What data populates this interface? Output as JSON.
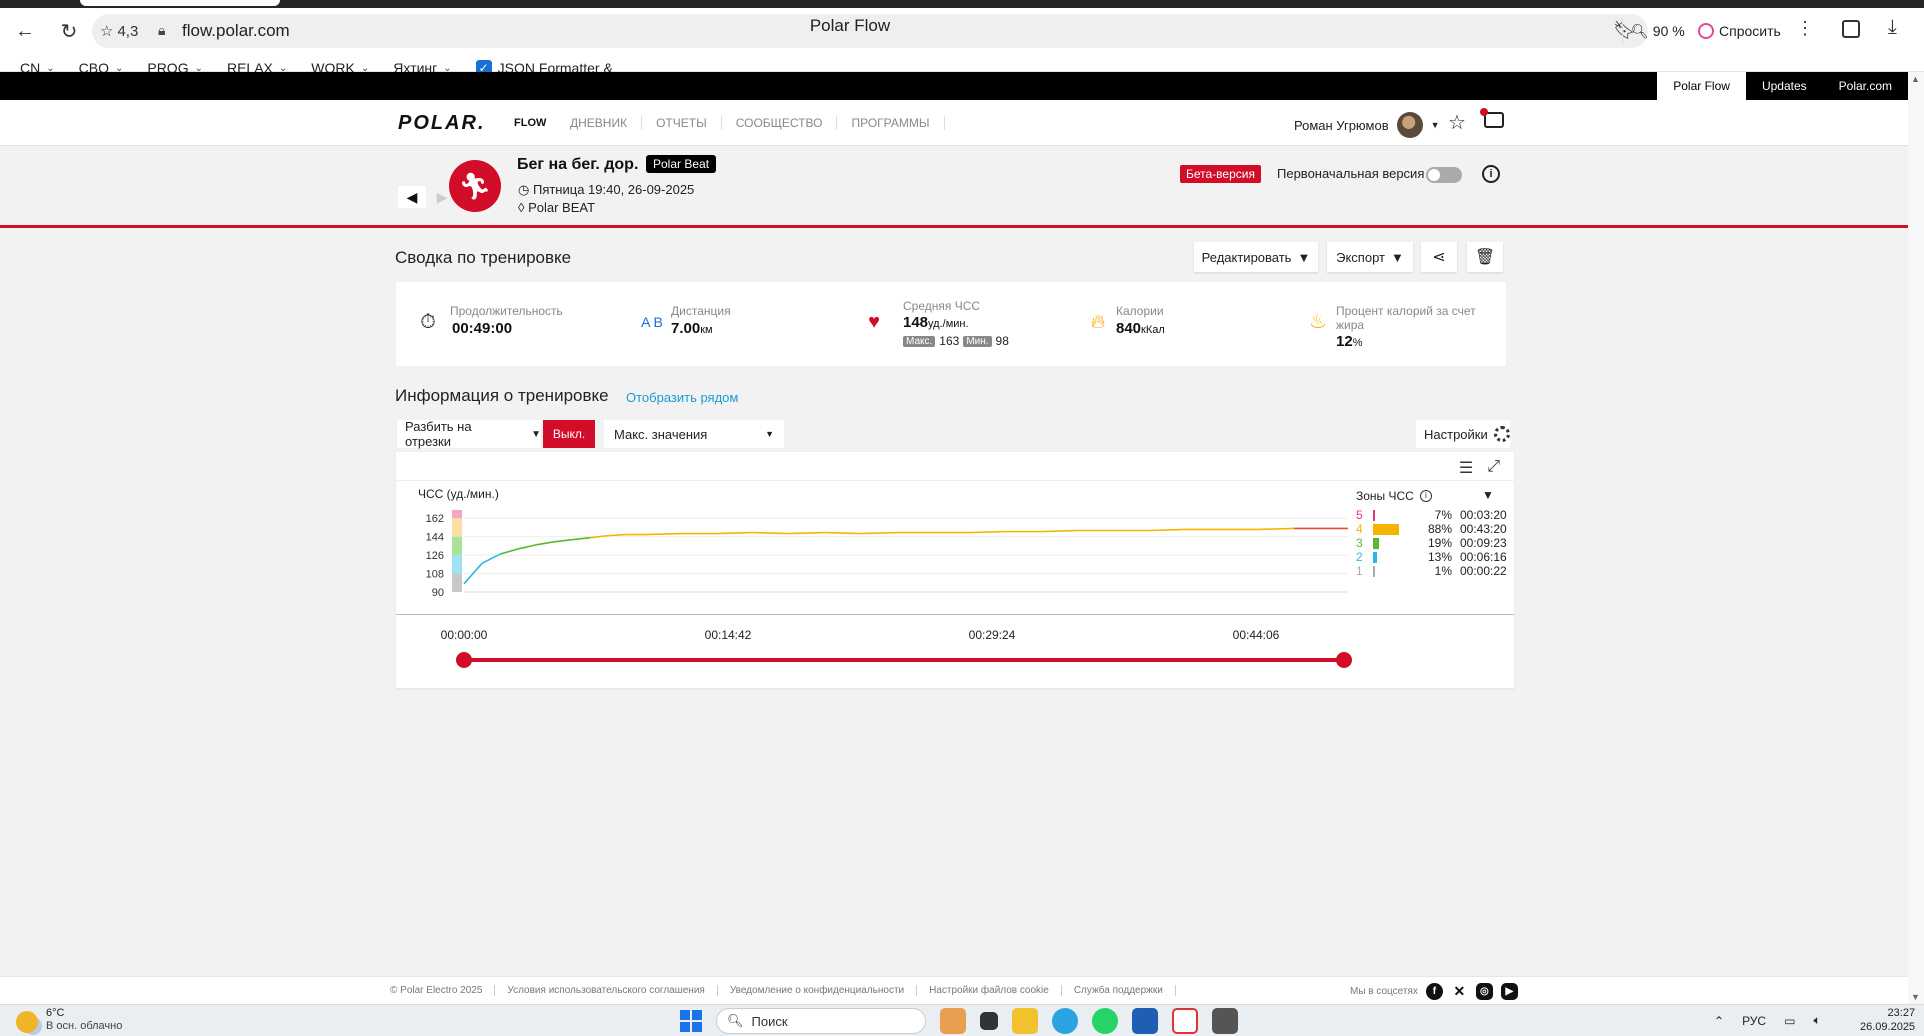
{
  "browser": {
    "rating": "4,3",
    "url": "flow.polar.com",
    "tab_title": "Polar Flow",
    "zoom": "90 %",
    "ask_label": "Спросить",
    "bookmarks": [
      {
        "label": "CN"
      },
      {
        "label": "CBO"
      },
      {
        "label": "PROG"
      },
      {
        "label": "RELAX"
      },
      {
        "label": "WORK"
      },
      {
        "label": "Яхтинг"
      },
      {
        "label": "JSON Formatter &"
      }
    ]
  },
  "topbar": {
    "links": [
      "Polar Flow",
      "Updates",
      "Polar.com"
    ]
  },
  "header": {
    "logo": "POLAR.",
    "logo_suffix": "FLOW",
    "nav": [
      "ДНЕВНИК",
      "ОТЧЕТЫ",
      "СООБЩЕСТВО",
      "ПРОГРАММЫ"
    ],
    "user_name": "Роман Угрюмов"
  },
  "session": {
    "title": "Бег на бег. дор.",
    "device_badge": "Polar Beat",
    "date": "Пятница 19:40, 26-09-2025",
    "device": "Polar BEAT",
    "beta": "Бета-версия",
    "original_version": "Первоначальная версия"
  },
  "summary": {
    "title": "Сводка по тренировке",
    "edit": "Редактировать",
    "export": "Экспорт",
    "stats": {
      "duration": {
        "label": "Продолжительность",
        "value": "00:49:00"
      },
      "distance": {
        "label": "Дистанция",
        "value": "7.00",
        "unit": "км"
      },
      "avg_hr": {
        "label": "Средняя ЧСС",
        "value": "148",
        "unit": "уд./мин.",
        "max_tag": "Макс.",
        "max": "163",
        "min_tag": "Мин.",
        "min": "98"
      },
      "calories": {
        "label": "Калории",
        "value": "840",
        "unit": "кКал"
      },
      "fat": {
        "label1": "Процент калорий за счет",
        "label2": "жира",
        "value": "12",
        "unit": "%"
      }
    }
  },
  "info": {
    "title": "Информация о тренировке",
    "side_by_side": "Отобразить рядом",
    "split": "Разбить на отрезки",
    "off": "Выкл.",
    "max_values": "Макс. значения",
    "settings": "Настройки"
  },
  "chart_data": {
    "type": "line",
    "ylabel": "ЧСС (уд./мин.)",
    "y_ticks": [
      90,
      108,
      126,
      144,
      162
    ],
    "ylim": [
      90,
      170
    ],
    "x_ticks": [
      "00:00:00",
      "00:14:42",
      "00:29:24",
      "00:44:06"
    ],
    "x_seconds": [
      0,
      60,
      120,
      180,
      240,
      300,
      360,
      420,
      480,
      540,
      600,
      720,
      840,
      960,
      1080,
      1200,
      1320,
      1440,
      1560,
      1680,
      1800,
      1920,
      2040,
      2160,
      2280,
      2400,
      2520,
      2640,
      2760,
      2880,
      2940
    ],
    "hr": [
      98,
      118,
      127,
      132,
      136,
      139,
      141,
      143,
      145,
      146,
      146,
      147,
      147,
      148,
      147,
      148,
      147,
      148,
      148,
      148,
      149,
      149,
      150,
      150,
      150,
      151,
      151,
      151,
      152,
      152,
      152
    ],
    "zones_title": "Зоны ЧСС",
    "zones": [
      {
        "zone": "5",
        "pct": "7%",
        "pct_value": 7,
        "time": "00:03:20",
        "color": "#e5387a"
      },
      {
        "zone": "4",
        "pct": "88%",
        "pct_value": 88,
        "time": "00:43:20",
        "color": "#f5b400"
      },
      {
        "zone": "3",
        "pct": "19%",
        "pct_value": 19,
        "time": "00:09:23",
        "color": "#56b831"
      },
      {
        "zone": "2",
        "pct": "13%",
        "pct_value": 13,
        "time": "00:06:16",
        "color": "#2cb6e8"
      },
      {
        "zone": "1",
        "pct": "1%",
        "pct_value": 1,
        "time": "00:00:22",
        "color": "#a8a8a8"
      }
    ]
  },
  "footer": {
    "links": [
      "© Polar Electro 2025",
      "Условия использовательского соглашения",
      "Уведомление о конфиденциальности",
      "Настройки файлов cookie",
      "Служба поддержки"
    ],
    "social_label": "Мы в соцсетях"
  },
  "taskbar": {
    "temp": "6°C",
    "weather": "В осн. облачно",
    "search": "Поиск",
    "lang": "РУС",
    "time": "23:27",
    "date": "26.09.2025"
  },
  "colors": {
    "accent": "#d10d2a",
    "link": "#1b9ad6"
  }
}
